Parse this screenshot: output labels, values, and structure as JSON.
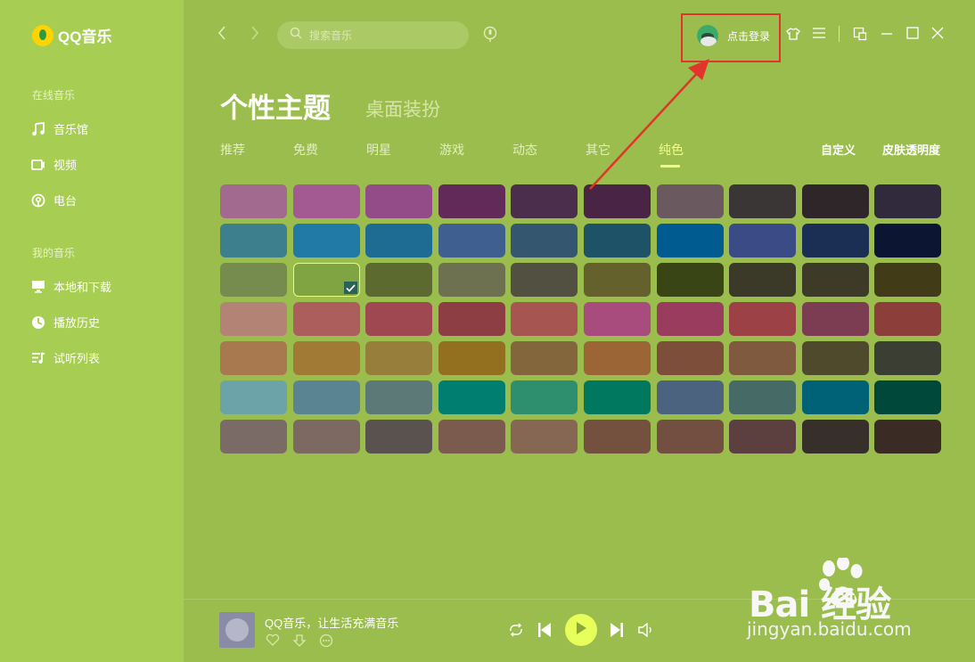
{
  "app": {
    "name": "QQ音乐"
  },
  "sidebar": {
    "section_online": "在线音乐",
    "online_items": [
      {
        "label": "音乐馆",
        "icon": "music-note-icon"
      },
      {
        "label": "视频",
        "icon": "video-icon"
      },
      {
        "label": "电台",
        "icon": "radio-icon"
      }
    ],
    "section_mine": "我的音乐",
    "my_items": [
      {
        "label": "本地和下载",
        "icon": "computer-icon"
      },
      {
        "label": "播放历史",
        "icon": "history-icon"
      },
      {
        "label": "试听列表",
        "icon": "playlist-icon"
      }
    ]
  },
  "topbar": {
    "search_placeholder": "搜索音乐",
    "login_label": "点击登录"
  },
  "page": {
    "title": "个性主题",
    "subtitle": "桌面装扮",
    "tabs": [
      "推荐",
      "免费",
      "明星",
      "游戏",
      "动态",
      "其它",
      "纯色"
    ],
    "active_tab": "纯色",
    "right_links": [
      "自定义",
      "皮肤透明度"
    ]
  },
  "swatches": [
    [
      "#a26a8e",
      "#a35a92",
      "#944c88",
      "#622a58",
      "#4a2e4c",
      "#4a2444",
      "#6b5960",
      "#3b3636",
      "#2f262a",
      "#302a3c"
    ],
    [
      "#3e7f8e",
      "#217aa6",
      "#1e6c93",
      "#3e5f8f",
      "#34566f",
      "#1d5267",
      "#005b91",
      "#3a4b85",
      "#1b2f55",
      "#0c1633"
    ],
    [
      "#768c4e",
      "#81a443",
      "#5c6a30",
      "#6e7150",
      "#525040",
      "#64612d",
      "#3a4515",
      "#3b3927",
      "#3d3b27",
      "#423b18"
    ],
    [
      "#b38476",
      "#ab5e5c",
      "#a04852",
      "#8d3e42",
      "#a75550",
      "#a84b7d",
      "#9a3c5e",
      "#9c4145",
      "#7c3c52",
      "#8b3e3a"
    ],
    [
      "#a8784e",
      "#a17b36",
      "#977e3b",
      "#93701f",
      "#84663c",
      "#9b6535",
      "#7d4f3a",
      "#805a3e",
      "#504a2d",
      "#3b3e33"
    ],
    [
      "#6ba3a8",
      "#5b8492",
      "#5c7877",
      "#007f71",
      "#2e8f6e",
      "#007860",
      "#4c6380",
      "#466a66",
      "#006276",
      "#00493a"
    ],
    [
      "#7b6b67",
      "#7b6962",
      "#59524e",
      "#7b5b4d",
      "#866753",
      "#74503e",
      "#734f42",
      "#5c4040",
      "#37302a",
      "#3a2c24"
    ]
  ],
  "selected_swatch": {
    "row": 2,
    "col": 1
  },
  "player": {
    "now_playing": "QQ音乐，让生活充满音乐"
  },
  "colors": {
    "sidebar": "#a7cd52",
    "main": "#9bbd4d",
    "accent": "#f4ff8a",
    "annotation": "#e2342b"
  },
  "watermark": {
    "logo": "Bai 经验",
    "url": "jingyan.baidu.com"
  }
}
